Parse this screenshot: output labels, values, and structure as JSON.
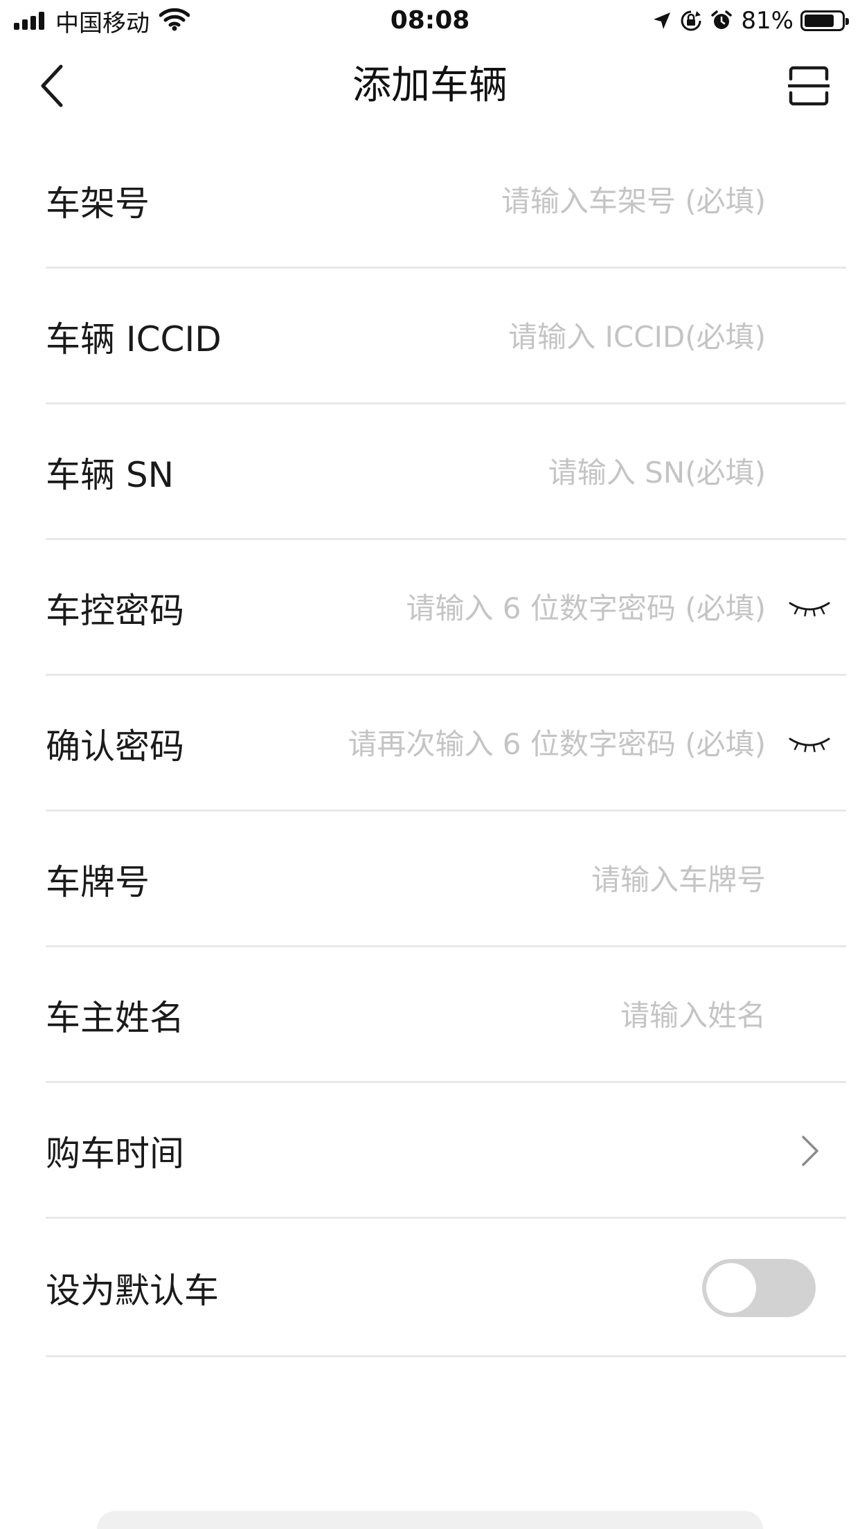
{
  "status_bar": {
    "carrier": "中国移动",
    "time": "08:08",
    "battery_percent": "81%",
    "battery_level": 0.81,
    "icons": [
      "signal-icon",
      "wifi-icon",
      "location-icon",
      "rotation-lock-icon",
      "alarm-icon",
      "battery-icon"
    ]
  },
  "nav": {
    "title": "添加车辆",
    "back_icon": "chevron-left-icon",
    "scan_icon": "scan-icon"
  },
  "form": {
    "frame_number": {
      "label": "车架号",
      "placeholder": "请输入车架号 (必填)"
    },
    "iccid": {
      "label": "车辆 ICCID",
      "placeholder": "请输入 ICCID(必填)"
    },
    "sn": {
      "label": "车辆 SN",
      "placeholder": "请输入 SN(必填)"
    },
    "control_password": {
      "label": "车控密码",
      "placeholder": "请输入 6 位数字密码 (必填)",
      "icon": "eye-closed-icon"
    },
    "confirm_password": {
      "label": "确认密码",
      "placeholder": "请再次输入 6 位数字密码 (必填)",
      "icon": "eye-closed-icon"
    },
    "plate_number": {
      "label": "车牌号",
      "placeholder": "请输入车牌号"
    },
    "owner_name": {
      "label": "车主姓名",
      "placeholder": "请输入姓名"
    },
    "purchase_time": {
      "label": "购车时间",
      "icon": "chevron-right-icon"
    },
    "set_default": {
      "label": "设为默认车",
      "checked": false
    }
  },
  "colors": {
    "text": "#1a1a1a",
    "placeholder": "#c4c4c4",
    "divider": "#e8e8e8",
    "toggle_off": "#d2d2d2"
  }
}
